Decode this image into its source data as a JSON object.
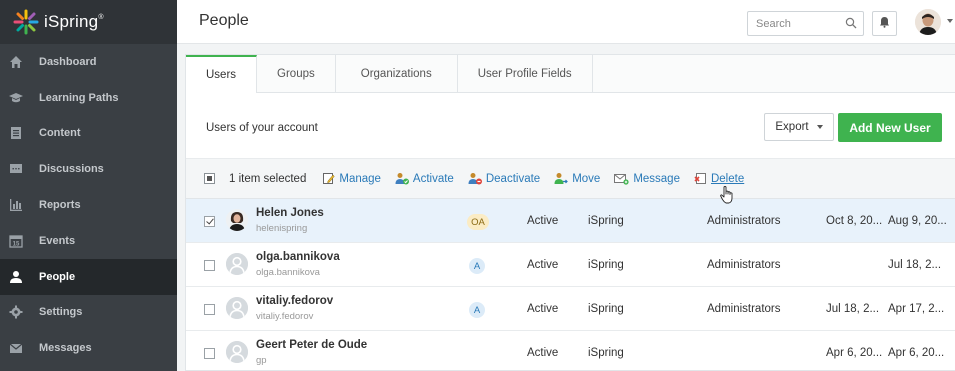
{
  "app": {
    "name": "iSpring",
    "trademark": "®"
  },
  "sidebar": {
    "items": [
      {
        "label": "Dashboard",
        "icon": "home-icon"
      },
      {
        "label": "Learning Paths",
        "icon": "graduation-cap-icon"
      },
      {
        "label": "Content",
        "icon": "document-icon"
      },
      {
        "label": "Discussions",
        "icon": "chat-icon"
      },
      {
        "label": "Reports",
        "icon": "bar-chart-icon"
      },
      {
        "label": "Events",
        "icon": "calendar-icon",
        "calendar_day": "15"
      },
      {
        "label": "People",
        "icon": "person-icon",
        "active": true
      },
      {
        "label": "Settings",
        "icon": "gear-icon"
      },
      {
        "label": "Messages",
        "icon": "envelope-icon"
      }
    ]
  },
  "header": {
    "title": "People",
    "search_placeholder": "Search"
  },
  "tabs": [
    {
      "label": "Users",
      "active": true
    },
    {
      "label": "Groups"
    },
    {
      "label": "Organizations"
    },
    {
      "label": "User Profile Fields"
    }
  ],
  "subheader": {
    "text": "Users of your account",
    "export_label": "Export",
    "add_label": "Add New User"
  },
  "toolbar": {
    "selected_text": "1 item selected",
    "actions": {
      "manage": "Manage",
      "activate": "Activate",
      "deactivate": "Deactivate",
      "move": "Move",
      "message": "Message",
      "delete": "Delete"
    }
  },
  "users": [
    {
      "name": "Helen Jones",
      "login": "helenispring",
      "role": "OA",
      "status": "Active",
      "organization": "iSpring",
      "group": "Administrators",
      "date1": "Oct 8, 20...",
      "date2": "Aug 9, 20...",
      "checked": true
    },
    {
      "name": "olga.bannikova",
      "login": "olga.bannikova",
      "role": "A",
      "status": "Active",
      "organization": "iSpring",
      "group": "Administrators",
      "date1": "",
      "date2": "Jul 18, 2..."
    },
    {
      "name": "vitaliy.fedorov",
      "login": "vitaliy.fedorov",
      "role": "A",
      "status": "Active",
      "organization": "iSpring",
      "group": "Administrators",
      "date1": "Jul 18, 2...",
      "date2": "Apr 17, 2..."
    },
    {
      "name": "Geert Peter de Oude",
      "login": "gp",
      "role": "",
      "status": "Active",
      "organization": "iSpring",
      "group": "",
      "date1": "Apr 6, 20...",
      "date2": "Apr 6, 20..."
    }
  ],
  "colors": {
    "accent_green": "#3fb34f",
    "link_blue": "#2a7ab8",
    "sidebar_bg": "#3a3f44"
  }
}
